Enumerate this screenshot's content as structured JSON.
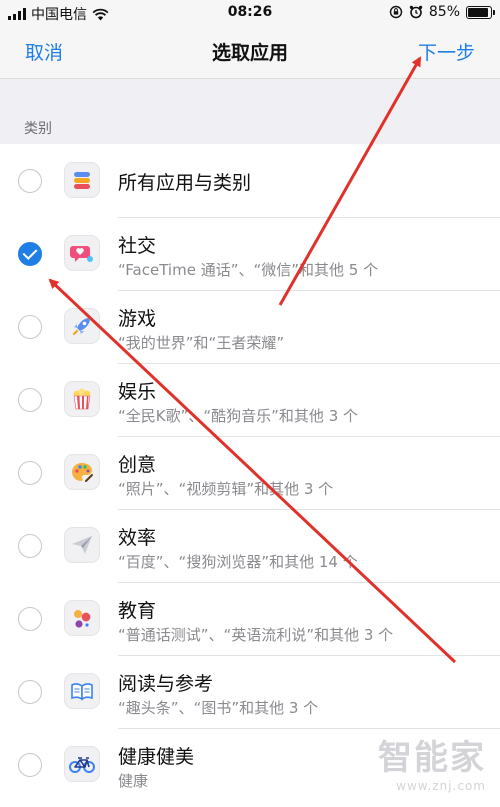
{
  "status_bar": {
    "carrier": "中国电信",
    "time": "08:26",
    "battery": "85%"
  },
  "nav": {
    "cancel": "取消",
    "title": "选取应用",
    "next": "下一步"
  },
  "section": {
    "label": "类别"
  },
  "categories": [
    {
      "title": "所有应用与类别",
      "subtitle": "",
      "checked": false,
      "icon": "stack-icon"
    },
    {
      "title": "社交",
      "subtitle": "“FaceTime 通话”、“微信”和其他 5 个",
      "checked": true,
      "icon": "chat-heart-icon"
    },
    {
      "title": "游戏",
      "subtitle": "“我的世界”和“王者荣耀”",
      "checked": false,
      "icon": "rocket-icon"
    },
    {
      "title": "娱乐",
      "subtitle": "“全民K歌”、“酷狗音乐”和其他 3 个",
      "checked": false,
      "icon": "popcorn-icon"
    },
    {
      "title": "创意",
      "subtitle": "“照片”、“视频剪辑”和其他 3 个",
      "checked": false,
      "icon": "palette-icon"
    },
    {
      "title": "效率",
      "subtitle": "“百度”、“搜狗浏览器”和其他 14 个",
      "checked": false,
      "icon": "paper-plane-icon"
    },
    {
      "title": "教育",
      "subtitle": "“普通话测试”、“英语流利说”和其他 3 个",
      "checked": false,
      "icon": "planet-icon"
    },
    {
      "title": "阅读与参考",
      "subtitle": "“趣头条”、“图书”和其他 3 个",
      "checked": false,
      "icon": "book-icon"
    },
    {
      "title": "健康健美",
      "subtitle": "健康",
      "checked": false,
      "icon": "bicycle-icon"
    }
  ],
  "watermark": {
    "text": "智能家",
    "url": "www.znj.com"
  },
  "colors": {
    "accent": "#1f7fe6",
    "annotation_arrow": "#e0322b"
  }
}
